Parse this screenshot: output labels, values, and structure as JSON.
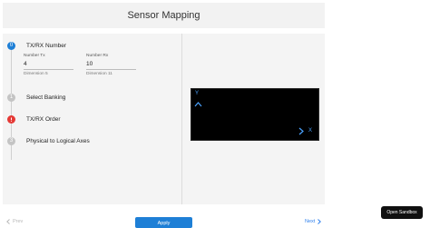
{
  "header": {
    "title": "Sensor Mapping"
  },
  "steps": [
    {
      "number": "0",
      "label": "TX/RX Number",
      "status": "active",
      "color": "#1e7fd6"
    },
    {
      "number": "1",
      "label": "Select Banking",
      "status": "inactive",
      "color": "#c4c4c4"
    },
    {
      "number": "2",
      "label": "TX/RX Order",
      "status": "error",
      "color": "#e53935"
    },
    {
      "number": "3",
      "label": "Physical to Logical Axes",
      "status": "inactive",
      "color": "#c4c4c4"
    }
  ],
  "fields": {
    "tx": {
      "label": "Number Tx",
      "value": "4",
      "hint": "Dimension 5"
    },
    "rx": {
      "label": "Number Rx",
      "value": "10",
      "hint": "Dimension 11"
    }
  },
  "preview": {
    "y_label": "Y",
    "x_label": "X"
  },
  "footer": {
    "prev_label": "Prev",
    "apply_label": "Apply",
    "next_label": "Next"
  },
  "sandbox": {
    "label": "Open Sandbox"
  },
  "colors": {
    "accent": "#1e7fd6",
    "error": "#e53935",
    "inactive": "#c4c4c4",
    "axis": "#4aa3ff"
  }
}
